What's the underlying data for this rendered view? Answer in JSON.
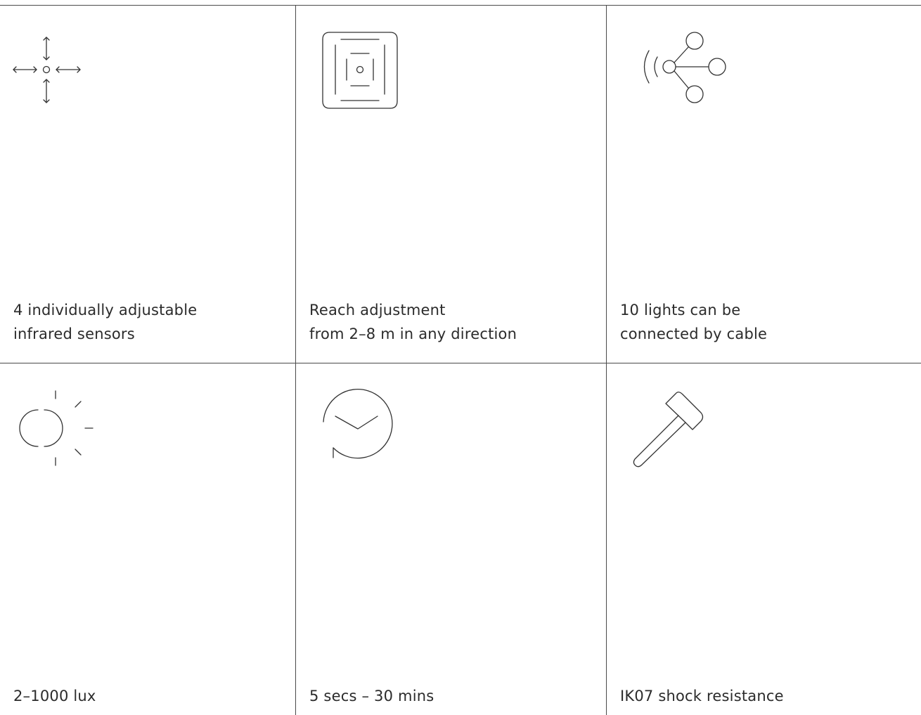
{
  "features": [
    {
      "icon": "four-way-arrows-icon",
      "lines": [
        "4 individually adjustable",
        "infrared sensors"
      ]
    },
    {
      "icon": "reach-square-icon",
      "lines": [
        "Reach adjustment",
        "from 2–8 m in any direction"
      ]
    },
    {
      "icon": "network-connection-icon",
      "lines": [
        "10 lights can be",
        "connected by cable"
      ]
    },
    {
      "icon": "day-night-icon",
      "lines": [
        "2–1000 lux"
      ]
    },
    {
      "icon": "clock-timer-icon",
      "lines": [
        "5 secs – 30 mins"
      ]
    },
    {
      "icon": "hammer-icon",
      "lines": [
        "IK07 shock resistance"
      ]
    }
  ]
}
